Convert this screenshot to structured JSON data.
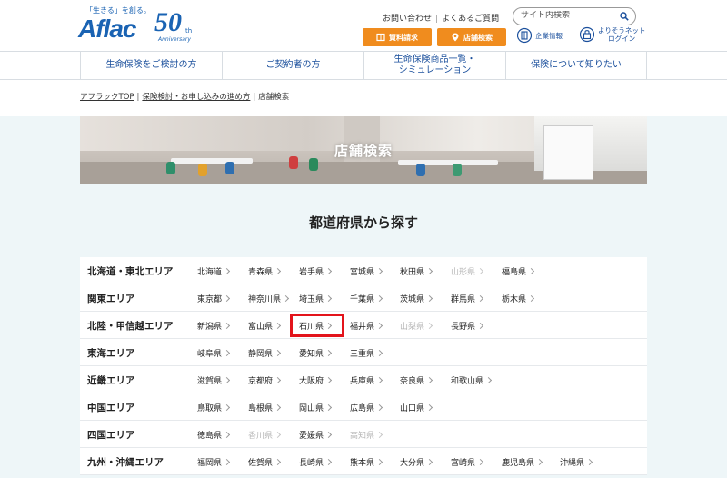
{
  "header": {
    "logo_tagline": "「生きる」を創る。",
    "logo_text": "Aflac",
    "logo_50": "50",
    "logo_th": "th",
    "logo_anniversary": "Anniversary",
    "contact_link": "お問い合わせ",
    "faq_link": "よくあるご質問",
    "search_placeholder": "サイト内検索",
    "docs_button": "資料請求",
    "store_button": "店舗検索",
    "company_link": "企業情報",
    "net_login_line1": "よりそうネット",
    "net_login_line2": "ログイン"
  },
  "nav": [
    {
      "label": "生命保険をご検討の方"
    },
    {
      "label": "ご契約者の方"
    },
    {
      "label": "生命保険商品一覧・\nシミュレーション"
    },
    {
      "label": "保険について知りたい"
    }
  ],
  "breadcrumb": {
    "home": "アフラックTOP",
    "middle": "保険検討・お申し込みの進め方",
    "current": "店舗検索",
    "separator": "|"
  },
  "hero": {
    "title": "店舗検索"
  },
  "section": {
    "title": "都道府県から探す"
  },
  "regions": [
    {
      "label": "北海道・東北エリア",
      "prefs": [
        {
          "name": "北海道",
          "enabled": true
        },
        {
          "name": "青森県",
          "enabled": true
        },
        {
          "name": "岩手県",
          "enabled": true
        },
        {
          "name": "宮城県",
          "enabled": true
        },
        {
          "name": "秋田県",
          "enabled": true
        },
        {
          "name": "山形県",
          "enabled": false
        },
        {
          "name": "福島県",
          "enabled": true
        }
      ]
    },
    {
      "label": "関東エリア",
      "prefs": [
        {
          "name": "東京都",
          "enabled": true
        },
        {
          "name": "神奈川県",
          "enabled": true
        },
        {
          "name": "埼玉県",
          "enabled": true
        },
        {
          "name": "千葉県",
          "enabled": true
        },
        {
          "name": "茨城県",
          "enabled": true
        },
        {
          "name": "群馬県",
          "enabled": true
        },
        {
          "name": "栃木県",
          "enabled": true
        }
      ]
    },
    {
      "label": "北陸・甲信越エリア",
      "prefs": [
        {
          "name": "新潟県",
          "enabled": true
        },
        {
          "name": "富山県",
          "enabled": true
        },
        {
          "name": "石川県",
          "enabled": true,
          "highlighted": true
        },
        {
          "name": "福井県",
          "enabled": true
        },
        {
          "name": "山梨県",
          "enabled": false
        },
        {
          "name": "長野県",
          "enabled": true
        }
      ]
    },
    {
      "label": "東海エリア",
      "prefs": [
        {
          "name": "岐阜県",
          "enabled": true
        },
        {
          "name": "静岡県",
          "enabled": true
        },
        {
          "name": "愛知県",
          "enabled": true
        },
        {
          "name": "三重県",
          "enabled": true
        }
      ]
    },
    {
      "label": "近畿エリア",
      "prefs": [
        {
          "name": "滋賀県",
          "enabled": true
        },
        {
          "name": "京都府",
          "enabled": true
        },
        {
          "name": "大阪府",
          "enabled": true
        },
        {
          "name": "兵庫県",
          "enabled": true
        },
        {
          "name": "奈良県",
          "enabled": true
        },
        {
          "name": "和歌山県",
          "enabled": true
        }
      ]
    },
    {
      "label": "中国エリア",
      "prefs": [
        {
          "name": "鳥取県",
          "enabled": true
        },
        {
          "name": "島根県",
          "enabled": true
        },
        {
          "name": "岡山県",
          "enabled": true
        },
        {
          "name": "広島県",
          "enabled": true
        },
        {
          "name": "山口県",
          "enabled": true
        }
      ]
    },
    {
      "label": "四国エリア",
      "prefs": [
        {
          "name": "徳島県",
          "enabled": true
        },
        {
          "name": "香川県",
          "enabled": false
        },
        {
          "name": "愛媛県",
          "enabled": true
        },
        {
          "name": "高知県",
          "enabled": false
        }
      ]
    },
    {
      "label": "九州・沖縄エリア",
      "prefs": [
        {
          "name": "福岡県",
          "enabled": true
        },
        {
          "name": "佐賀県",
          "enabled": true
        },
        {
          "name": "長崎県",
          "enabled": true
        },
        {
          "name": "熊本県",
          "enabled": true
        },
        {
          "name": "大分県",
          "enabled": true
        },
        {
          "name": "宮崎県",
          "enabled": true
        },
        {
          "name": "鹿児島県",
          "enabled": true
        },
        {
          "name": "沖縄県",
          "enabled": true
        }
      ]
    }
  ],
  "colors": {
    "brand_blue": "#1a63b3",
    "accent_orange": "#f08c1e",
    "highlight_red": "#e3141b",
    "page_bg": "#eef6f8"
  }
}
